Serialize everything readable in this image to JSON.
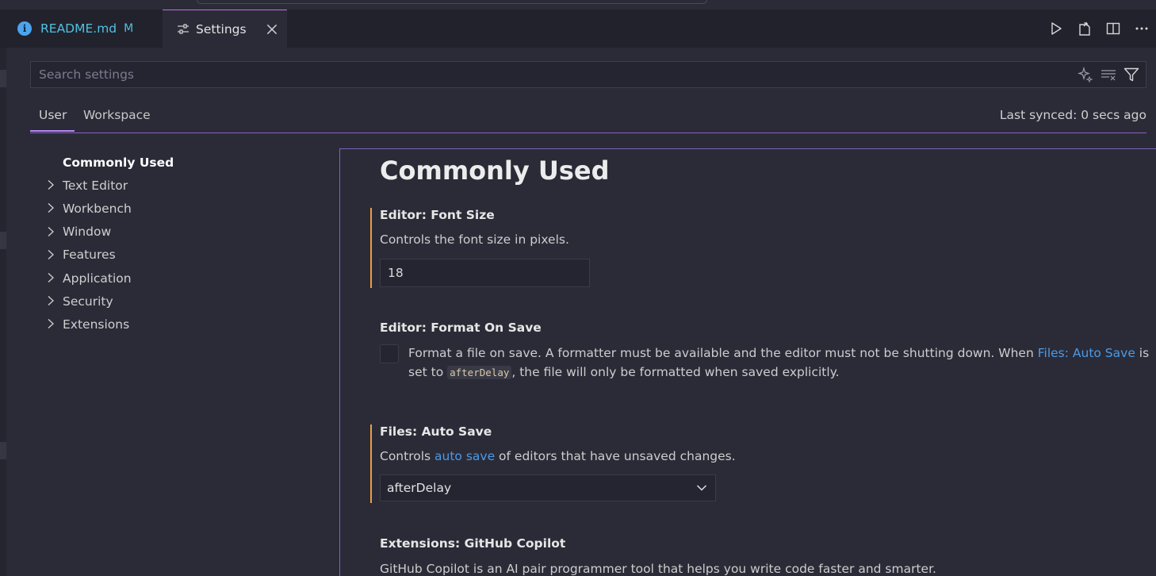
{
  "tabs": {
    "readme": {
      "label": "README.md",
      "badge": "M",
      "icon": "info-icon"
    },
    "settings": {
      "label": "Settings",
      "icon": "sliders-icon"
    }
  },
  "editor_actions": [
    "run-icon",
    "open-file-icon",
    "split-editor-icon",
    "more-actions-icon"
  ],
  "search": {
    "placeholder": "Search settings",
    "tools": [
      "sparkle-icon",
      "clear-filter-icon",
      "filter-icon"
    ]
  },
  "scope": {
    "user_label": "User",
    "workspace_label": "Workspace",
    "last_synced": "Last synced: 0 secs ago"
  },
  "toc": {
    "items": [
      {
        "label": "Commonly Used",
        "active": true
      },
      {
        "label": "Text Editor"
      },
      {
        "label": "Workbench"
      },
      {
        "label": "Window"
      },
      {
        "label": "Features"
      },
      {
        "label": "Application"
      },
      {
        "label": "Security"
      },
      {
        "label": "Extensions"
      }
    ]
  },
  "section_title": "Commonly Used",
  "settings": {
    "font_size": {
      "category": "Editor: ",
      "name": "Font Size",
      "description": "Controls the font size in pixels.",
      "value": "18"
    },
    "format_on_save": {
      "category": "Editor: ",
      "name": "Format On Save",
      "desc_part1": "Format a file on save. A formatter must be available and the editor must not be shutting down. When ",
      "desc_link": "Files: Auto Save",
      "desc_part2": " is set to ",
      "desc_code": "afterDelay",
      "desc_part3": ", the file will only be formatted when saved explicitly.",
      "checked": false
    },
    "auto_save": {
      "category": "Files: ",
      "name": "Auto Save",
      "desc_part1": "Controls ",
      "desc_link": "auto save",
      "desc_part2": " of editors that have unsaved changes.",
      "value": "afterDelay"
    },
    "copilot": {
      "category": "Extensions: ",
      "name": "GitHub Copilot",
      "description": "GitHub Copilot is an AI pair programmer tool that helps you write code faster and smarter."
    }
  },
  "colors": {
    "accent": "#b488ec",
    "modified_indicator": "#e8a046",
    "link": "#4a9ae8"
  }
}
